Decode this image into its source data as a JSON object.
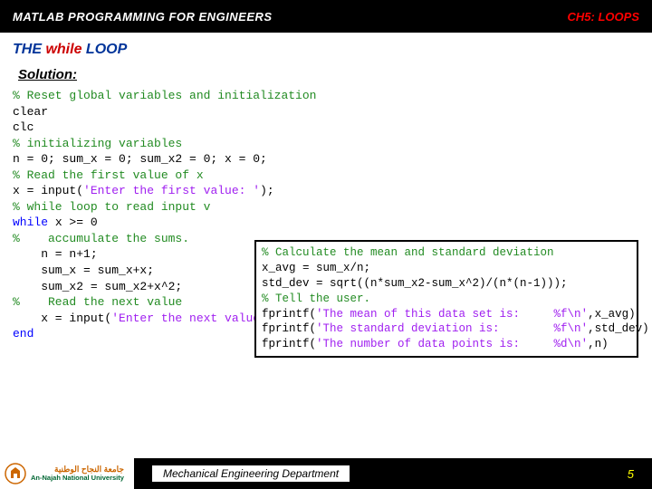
{
  "header": {
    "left": "MATLAB PROGRAMMING FOR ENGINEERS",
    "right_prefix": "CH5:",
    "right_suffix": " LOOPS"
  },
  "section": {
    "prefix": "THE ",
    "keyword": "while",
    "suffix": " LOOP"
  },
  "subtitle": "Solution:",
  "code": {
    "l01": "% Reset global variables and initialization",
    "l02": "clear",
    "l03": "clc",
    "l04": "",
    "l05": "% initializing variables",
    "l06a": "n = 0; sum_x = 0; sum_x2 = 0; x = 0;",
    "l07": "",
    "l08": "% Read the first value of x",
    "l09a": "x = input(",
    "l09b": "'Enter the first value: '",
    "l09c": ");",
    "l10": "",
    "l11": "% while loop to read input v",
    "l12a": "while",
    "l12b": " x >= 0",
    "l13": "%    accumulate the sums.",
    "l14": "    n = n+1;",
    "l15": "    sum_x = sum_x+x;",
    "l16": "    sum_x2 = sum_x2+x^2;",
    "l17": "",
    "l18": "%    Read the next value",
    "l19a": "    x = input(",
    "l19b": "'Enter the next value: '",
    "l19c": ");",
    "l20": "end"
  },
  "inset": {
    "b01": "% Calculate the mean and standard deviation",
    "b02": "x_avg = sum_x/n;",
    "b03": "std_dev = sqrt((n*sum_x2-sum_x^2)/(n*(n-1)));",
    "b04": "",
    "b05": "% Tell the user.",
    "b06a": "fprintf(",
    "b06b": "'The mean of this data set is:     %f\\n'",
    "b06c": ",x_avg)",
    "b07a": "fprintf(",
    "b07b": "'The standard deviation is:        %f\\n'",
    "b07c": ",std_dev)",
    "b08a": "fprintf(",
    "b08b": "'The number of data points is:     %d\\n'",
    "b08c": ",n)"
  },
  "footer": {
    "uni_ar": "جامعة النجاح الوطنية",
    "uni_en": "An-Najah National University",
    "dept": "Mechanical Engineering Department",
    "page": "5"
  }
}
